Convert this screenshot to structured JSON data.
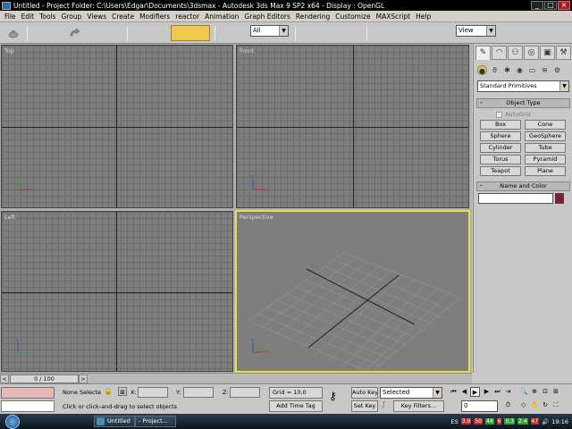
{
  "window": {
    "title": "Untitled     - Project Folder: C:\\Users\\Edgar\\Documents\\3dsmax     - Autodesk 3ds Max 9 SP2 x64     - Display : OpenGL",
    "controls": [
      "_",
      "□",
      "×"
    ]
  },
  "menu": [
    "File",
    "Edit",
    "Tools",
    "Group",
    "Views",
    "Create",
    "Modifiers",
    "reactor",
    "Animation",
    "Graph Editors",
    "Rendering",
    "Customize",
    "MAXScript",
    "Help"
  ],
  "toolbar": {
    "selection_filter": "All",
    "reference_coord": "View"
  },
  "viewports": {
    "top_label": "Top",
    "front_label": "Front",
    "left_label": "Left",
    "perspective_label": "Perspective",
    "active": "Perspective"
  },
  "command_panel": {
    "tabs": [
      "create-icon",
      "modify-icon",
      "hierarchy-icon",
      "motion-icon",
      "display-icon",
      "utilities-icon"
    ],
    "subcategory_icons": [
      "geometry-icon",
      "shapes-icon",
      "lights-icon",
      "cameras-icon",
      "helpers-icon",
      "spacewarps-icon",
      "systems-icon"
    ],
    "category_dropdown": "Standard Primitives",
    "object_type_header": "Object Type",
    "autogrid_label": "AutoGrid",
    "objects": [
      "Box",
      "Cone",
      "Sphere",
      "GeoSphere",
      "Cylinder",
      "Tube",
      "Torus",
      "Pyramid",
      "Teapot",
      "Plane"
    ],
    "name_color_header": "Name and Color",
    "name_value": "",
    "color": "#8a1a32",
    "rollout_toggle": "-"
  },
  "time_slider": {
    "frame_label": "0 / 100",
    "prev_arrow": "<",
    "next_arrow": ">"
  },
  "status": {
    "selection_text": "None Selecte",
    "x_label": "X:",
    "y_label": "Y:",
    "z_label": "Z:",
    "grid_text": "Grid = 10,0",
    "prompt": "Click or click-and-drag to select objects",
    "add_time_tag": "Add Time Tag",
    "auto_key": "Auto Key",
    "set_key": "Set Key",
    "key_mode": "Selected",
    "key_filters": "Key Filters...",
    "current_frame": "0"
  },
  "taskbar": {
    "item1": "Untitled",
    "item2": "- Project...",
    "language": "ES",
    "tray_values": [
      "3.9",
      "50",
      "44",
      "6",
      "0.3",
      "2.4",
      "47"
    ],
    "clock": "19:16"
  }
}
